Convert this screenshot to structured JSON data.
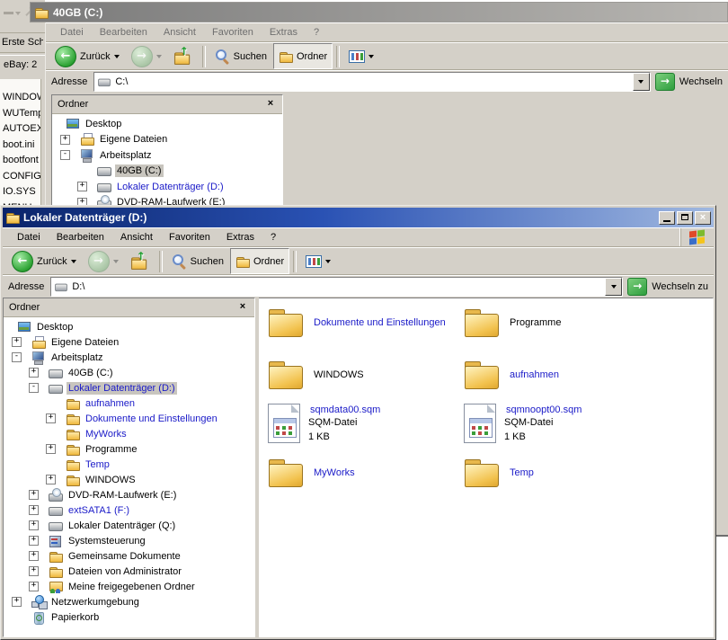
{
  "strip": {
    "links": [
      "Erste Sch",
      "eBay: 2"
    ],
    "files": [
      "WINDOW",
      "WUTemp",
      "AUTOEX",
      "boot.ini",
      "bootfont",
      "CONFIG.",
      "IO.SYS",
      "MENU"
    ]
  },
  "back_window": {
    "title": "40GB (C:)",
    "menu": [
      "Datei",
      "Bearbeiten",
      "Ansicht",
      "Favoriten",
      "Extras",
      "?"
    ],
    "toolbar": {
      "back": "Zurück",
      "search": "Suchen",
      "folders": "Ordner"
    },
    "address": {
      "label": "Adresse",
      "value": "C:\\",
      "go": "Wechseln"
    },
    "panel": {
      "header": "Ordner"
    },
    "tree": [
      {
        "label": "Desktop",
        "level": 0,
        "icon": "desktop",
        "exp": ""
      },
      {
        "label": "Eigene Dateien",
        "level": 1,
        "icon": "mydocs",
        "exp": "+"
      },
      {
        "label": "Arbeitsplatz",
        "level": 1,
        "icon": "computer",
        "exp": "-"
      },
      {
        "label": "40GB (C:)",
        "level": 2,
        "icon": "drive",
        "exp": "",
        "sel": true
      },
      {
        "label": "Lokaler Datenträger (D:)",
        "level": 2,
        "icon": "drive",
        "exp": "+",
        "blue": true
      },
      {
        "label": "DVD-RAM-Laufwerk (E:)",
        "level": 2,
        "icon": "cd",
        "exp": "+"
      }
    ]
  },
  "front_window": {
    "title": "Lokaler Datenträger (D:)",
    "menu": [
      "Datei",
      "Bearbeiten",
      "Ansicht",
      "Favoriten",
      "Extras",
      "?"
    ],
    "toolbar": {
      "back": "Zurück",
      "search": "Suchen",
      "folders": "Ordner"
    },
    "address": {
      "label": "Adresse",
      "value": "D:\\",
      "go": "Wechseln zu"
    },
    "panel": {
      "header": "Ordner"
    },
    "tree": [
      {
        "label": "Desktop",
        "level": 0,
        "icon": "desktop",
        "exp": ""
      },
      {
        "label": "Eigene Dateien",
        "level": 1,
        "icon": "mydocs",
        "exp": "+"
      },
      {
        "label": "Arbeitsplatz",
        "level": 1,
        "icon": "computer",
        "exp": "-"
      },
      {
        "label": "40GB (C:)",
        "level": 2,
        "icon": "drive",
        "exp": "+"
      },
      {
        "label": "Lokaler Datenträger (D:)",
        "level": 2,
        "icon": "drive",
        "exp": "-",
        "blue": true,
        "sel": true
      },
      {
        "label": "aufnahmen",
        "level": 3,
        "icon": "folder",
        "exp": "",
        "blue": true
      },
      {
        "label": "Dokumente und Einstellungen",
        "level": 3,
        "icon": "folder",
        "exp": "+",
        "blue": true
      },
      {
        "label": "MyWorks",
        "level": 3,
        "icon": "folder",
        "exp": "",
        "blue": true
      },
      {
        "label": "Programme",
        "level": 3,
        "icon": "folder",
        "exp": "+"
      },
      {
        "label": "Temp",
        "level": 3,
        "icon": "folder",
        "exp": "",
        "blue": true
      },
      {
        "label": "WINDOWS",
        "level": 3,
        "icon": "folder",
        "exp": "+"
      },
      {
        "label": "DVD-RAM-Laufwerk (E:)",
        "level": 2,
        "icon": "cd",
        "exp": "+"
      },
      {
        "label": "extSATA1 (F:)",
        "level": 2,
        "icon": "drive",
        "exp": "+",
        "blue": true
      },
      {
        "label": "Lokaler Datenträger (Q:)",
        "level": 2,
        "icon": "drive",
        "exp": "+"
      },
      {
        "label": "Systemsteuerung",
        "level": 2,
        "icon": "control",
        "exp": "+"
      },
      {
        "label": "Gemeinsame Dokumente",
        "level": 2,
        "icon": "folder",
        "exp": "+"
      },
      {
        "label": "Dateien von Administrator",
        "level": 2,
        "icon": "folder",
        "exp": "+"
      },
      {
        "label": "Meine freigegebenen Ordner",
        "level": 2,
        "icon": "shared",
        "exp": "+"
      },
      {
        "label": "Netzwerkumgebung",
        "level": 1,
        "icon": "network",
        "exp": "+"
      },
      {
        "label": "Papierkorb",
        "level": 1,
        "icon": "recycle",
        "exp": ""
      }
    ],
    "tiles": [
      {
        "label": "Dokumente und Einstellungen",
        "icon": "folder",
        "blue": true,
        "sub": []
      },
      {
        "label": "Programme",
        "icon": "folder",
        "blue": false,
        "sub": []
      },
      {
        "label": "WINDOWS",
        "icon": "folder",
        "blue": false,
        "sub": []
      },
      {
        "label": "aufnahmen",
        "icon": "folder",
        "blue": true,
        "sub": []
      },
      {
        "label": "sqmdata00.sqm",
        "icon": "sqm",
        "blue": true,
        "sub": [
          "SQM-Datei",
          "1 KB"
        ]
      },
      {
        "label": "sqmnoopt00.sqm",
        "icon": "sqm",
        "blue": true,
        "sub": [
          "SQM-Datei",
          "1 KB"
        ]
      },
      {
        "label": "MyWorks",
        "icon": "folder",
        "blue": true,
        "sub": []
      },
      {
        "label": "Temp",
        "icon": "folder",
        "blue": true,
        "sub": []
      }
    ]
  },
  "colors": {
    "classic_face": "#D4D0C8",
    "title_active_left": "#0A246A",
    "title_active_right": "#A6CAF0",
    "compressed_blue": "#1A1AC8",
    "go_button_green": "#2E9E3E"
  }
}
